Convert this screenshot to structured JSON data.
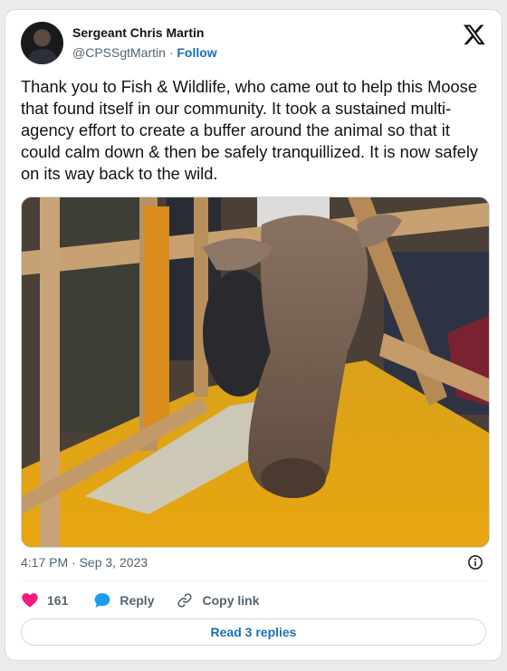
{
  "author": {
    "name": "Sergeant Chris Martin",
    "handle": "@CPSSgtMartin",
    "separator": "·",
    "follow_label": "Follow"
  },
  "icons": {
    "brand": "x-logo-icon",
    "info": "info-icon",
    "like": "heart-icon",
    "reply": "reply-bubble-icon",
    "copy": "link-icon"
  },
  "tweet": {
    "text": "Thank you to Fish & Wildlife, who came out to help this Moose that found itself in our community. It took a sustained multi-agency effort to create a buffer around the animal so that it could calm down & then be safely tranquillized. It is now safely on its way back to the wild."
  },
  "meta": {
    "time": "4:17 PM",
    "separator": "·",
    "date": "Sep 3, 2023"
  },
  "actions": {
    "likes": "161",
    "reply_label": "Reply",
    "copy_label": "Copy link"
  },
  "footer": {
    "read_replies_label": "Read 3 replies"
  },
  "colors": {
    "like": "#f91880",
    "link": "#1d6fb0",
    "muted": "#536471",
    "reply_icon": "#1d9bf0"
  }
}
